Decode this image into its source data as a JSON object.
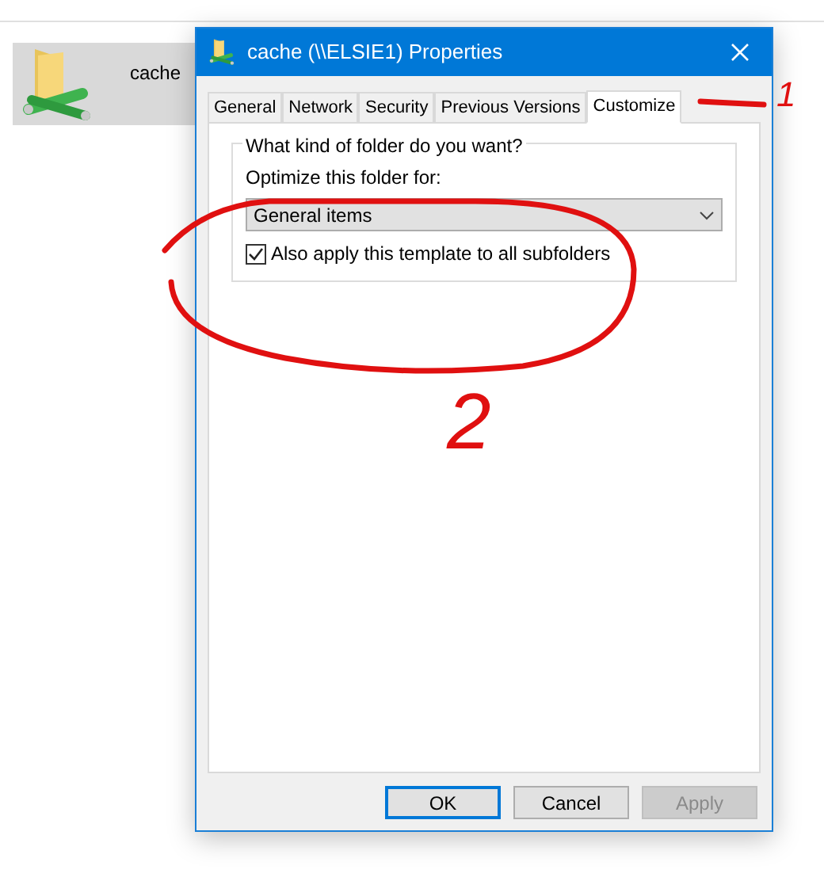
{
  "explorer": {
    "items": [
      {
        "name": "cache",
        "selected": true
      }
    ]
  },
  "dialog": {
    "title": "cache (\\\\ELSIE1) Properties",
    "tabs": [
      {
        "label": "General",
        "selected": false
      },
      {
        "label": "Network",
        "selected": false
      },
      {
        "label": "Security",
        "selected": false
      },
      {
        "label": "Previous Versions",
        "selected": false
      },
      {
        "label": "Customize",
        "selected": true
      }
    ],
    "group": {
      "title": "What kind of folder do you want?",
      "optimize_label": "Optimize this folder for:",
      "dropdown": {
        "value": "General items"
      },
      "checkbox": {
        "label": "Also apply this template to all subfolders",
        "checked": true
      }
    },
    "buttons": [
      {
        "label": "OK",
        "default": true,
        "disabled": false
      },
      {
        "label": "Cancel",
        "default": false,
        "disabled": false
      },
      {
        "label": "Apply",
        "default": false,
        "disabled": true
      }
    ]
  },
  "annotations": [
    {
      "text": "1"
    },
    {
      "text": "2"
    }
  ]
}
